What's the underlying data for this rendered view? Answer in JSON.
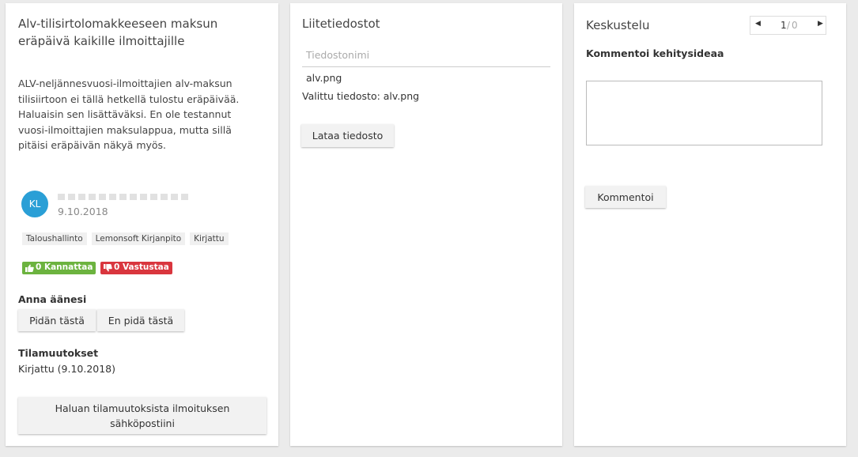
{
  "idea": {
    "title": "Alv-tilisirtolomakkeeseen maksun eräpäivä kaikille ilmoittajille",
    "description": "ALV-neljännesvuosi-ilmoittajien alv-maksun tilisiirtoon ei tällä hetkellä tulostu eräpäivää. Haluaisin sen lisättäväksi. En ole testannut vuosi-ilmoittajien maksulappua, mutta sillä pitäisi eräpäivän näkyä myös.",
    "author": {
      "initials": "KL",
      "date": "9.10.2018"
    },
    "tags": [
      "Taloushallinto",
      "Lemonsoft Kirjanpito",
      "Kirjattu"
    ],
    "support_badge": "0 Kannattaa",
    "oppose_badge": "0 Vastustaa",
    "vote_heading": "Anna äänesi",
    "vote_like": "Pidän tästä",
    "vote_dislike": "En pidä tästä",
    "status_heading": "Tilamuutokset",
    "status_entry": "Kirjattu (9.10.2018)",
    "notify_button": "Haluan tilamuutoksista ilmoituksen sähköpostiini"
  },
  "attachments": {
    "title": "Liitetiedostot",
    "filename_placeholder": "Tiedostonimi",
    "file": "alv.png",
    "selected_text": "Valittu tiedosto: alv.png",
    "upload_button": "Lataa tiedosto"
  },
  "discussion": {
    "title": "Keskustelu",
    "pager_current": "1",
    "pager_total": "0",
    "comment_label": "Kommentoi kehitysideaa",
    "comment_button": "Kommentoi"
  },
  "colors": {
    "avatar": "#2a9fd6",
    "support": "#6cb33f",
    "oppose": "#d9363e"
  }
}
